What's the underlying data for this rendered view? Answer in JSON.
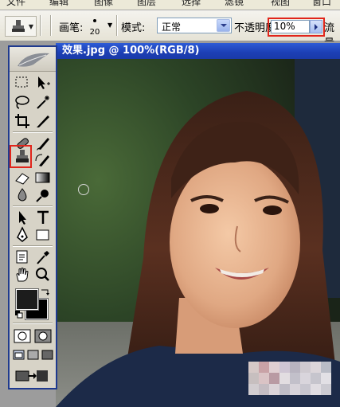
{
  "menu": {
    "items": [
      "文件",
      "编辑",
      "图像",
      "图层",
      "选择",
      "滤镜",
      "视图",
      "窗口"
    ]
  },
  "options": {
    "brush_label": "画笔:",
    "brush_size": "20",
    "mode_label": "模式:",
    "mode_value": "正常",
    "opacity_label": "不透明度:",
    "opacity_value": "10%",
    "flow_label": "流量"
  },
  "document": {
    "title": "效果.jpg @ 100%(RGB/8)"
  },
  "colors": {
    "highlight": "#e1251b",
    "title_bar": "#1c3fb5",
    "foreground": "#1c1c1c",
    "background": "#000000"
  },
  "toolbox": {
    "tools": [
      "marquee-icon",
      "move-icon",
      "lasso-icon",
      "magic-wand-icon",
      "crop-icon",
      "slice-icon",
      "healing-brush-icon",
      "brush-icon",
      "clone-stamp-icon",
      "history-brush-icon",
      "eraser-icon",
      "gradient-icon",
      "blur-icon",
      "dodge-icon",
      "path-select-icon",
      "type-icon",
      "pen-icon",
      "shape-icon",
      "notes-icon",
      "eyedropper-icon",
      "hand-icon",
      "zoom-icon"
    ],
    "selected_tool": "clone-stamp-icon"
  }
}
